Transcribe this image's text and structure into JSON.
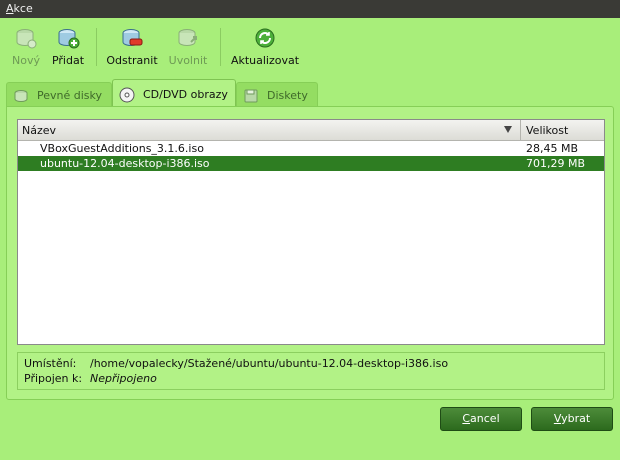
{
  "menubar": {
    "action_menu": "Akce"
  },
  "toolbar": {
    "new_label": "Nový",
    "add_label": "Přidat",
    "remove_label": "Odstranit",
    "release_label": "Uvolnit",
    "refresh_label": "Aktualizovat"
  },
  "tabs": [
    {
      "label": "Pevné disky"
    },
    {
      "label": "CD/DVD obrazy"
    },
    {
      "label": "Diskety"
    }
  ],
  "list": {
    "col_name": "Název",
    "col_size": "Velikost",
    "rows": [
      {
        "name": "VBoxGuestAdditions_3.1.6.iso",
        "size": "28,45 MB"
      },
      {
        "name": "ubuntu-12.04-desktop-i386.iso",
        "size": "701,29 MB"
      }
    ]
  },
  "info": {
    "location_key": "Umístění:",
    "location_value": "/home/vopalecky/Stažené/ubuntu/ubuntu-12.04-desktop-i386.iso",
    "attached_key": "Připojen k:",
    "attached_value": "Nepřipojeno"
  },
  "buttons": {
    "cancel": "Cancel",
    "select": "Vybrat"
  },
  "colors": {
    "background": "#a8ee7a",
    "selection": "#2e7d22",
    "button": "#2c6a1d"
  }
}
